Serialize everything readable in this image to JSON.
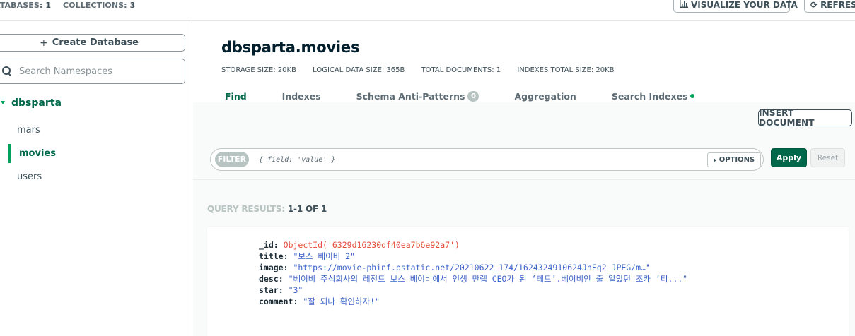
{
  "topbar": {
    "databases_label": "ATABASES:",
    "databases_count": "1",
    "collections_label": "COLLECTIONS:",
    "collections_count": "3",
    "visualize_label": "VISUALIZE YOUR DATA",
    "refresh_label": "REFRESH"
  },
  "sidebar": {
    "create_db_label": "Create Database",
    "search_placeholder": "Search Namespaces",
    "database": "dbsparta",
    "collections": [
      "mars",
      "movies",
      "users"
    ],
    "active_collection": "movies"
  },
  "main": {
    "namespace_title": "dbsparta.movies",
    "stats": {
      "storage": "STORAGE SIZE: 20KB",
      "logical": "LOGICAL DATA SIZE: 365B",
      "documents": "TOTAL DOCUMENTS: 1",
      "indexes": "INDEXES TOTAL SIZE: 20KB"
    },
    "tabs": [
      {
        "label": "Find",
        "active": true
      },
      {
        "label": "Indexes"
      },
      {
        "label": "Schema Anti-Patterns",
        "count": "0"
      },
      {
        "label": "Aggregation"
      },
      {
        "label": "Search Indexes",
        "indicator": "green-dot"
      }
    ],
    "insert_document_label": "INSERT DOCUMENT",
    "filter": {
      "pill_label": "FILTER",
      "placeholder": "{ field: 'value' }",
      "options_label": "OPTIONS",
      "apply_label": "Apply",
      "reset_label": "Reset"
    },
    "query_results_label": "QUERY RESULTS:",
    "query_results_range": "1-1 OF 1",
    "document": {
      "id_key": "_id:",
      "id_value": "ObjectId('6329d16230df40ea7b6e92a7')",
      "title_key": "title:",
      "title_value": "\"보스 베이비 2\"",
      "image_key": "image:",
      "image_value": "\"https://movie-phinf.pstatic.net/20210622_174/1624324910624JhEq2_JPEG/m…\"",
      "desc_key": "desc:",
      "desc_value": "\"베이비 주식회사의 레전드 보스 베이비에서 인생 만렙 CEO가 된 ‘테드’.베이비인 줄 알았던 조카 ‘티...\"",
      "star_key": "star:",
      "star_value": "\"3\"",
      "comment_key": "comment:",
      "comment_value": "\"잘 되나 확인하자!\""
    }
  },
  "colors": {
    "accent_green": "#00684a",
    "active_indicator": "#00a35c",
    "object_id": "#e74c3c",
    "string_value": "#3b62c8"
  }
}
